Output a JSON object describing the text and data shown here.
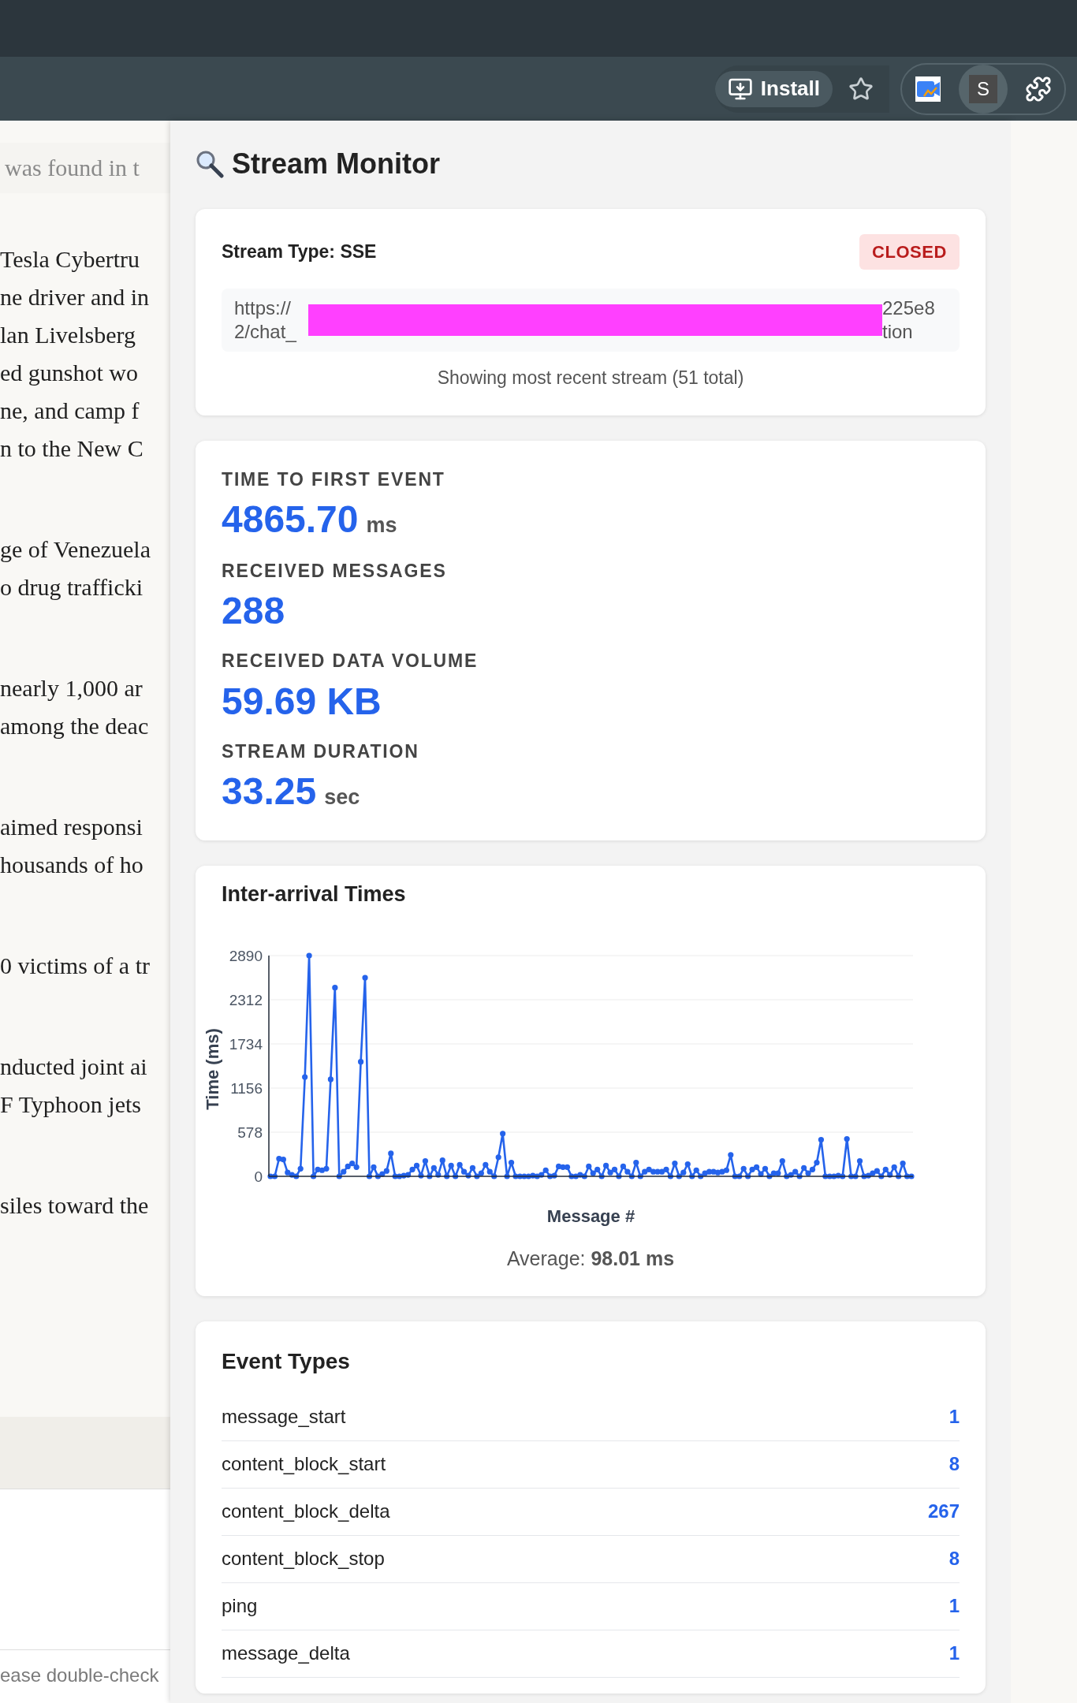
{
  "browser_toolbar": {
    "install_button": "Install",
    "avatar_initial": "S"
  },
  "background_page": {
    "summary": "was found in t",
    "paragraphs": [
      [
        "Tesla Cybertru",
        "ne driver and in",
        "lan Livelsberg",
        "ed gunshot wo",
        "ne, and camp f",
        "n to the New C"
      ],
      [
        "ge of Venezuela",
        "o drug trafficki"
      ],
      [
        "nearly 1,000 ar",
        "among the deac"
      ],
      [
        "aimed responsi",
        "housands of ho"
      ],
      [
        "0 victims of a tr"
      ],
      [
        "nducted joint ai",
        "F Typhoon jets"
      ],
      [
        "siles toward the"
      ]
    ],
    "footer_text": "ease double-check"
  },
  "panel": {
    "title": "Stream Monitor",
    "stream_card": {
      "stream_type": "Stream Type: SSE",
      "status": {
        "label": "CLOSED",
        "kind": "closed"
      },
      "url_lines": [
        {
          "start": "https://",
          "end": "225e8"
        },
        {
          "start": "2/chat_",
          "end": "tion"
        }
      ],
      "note": "Showing most recent stream (51 total)"
    },
    "metrics": [
      {
        "label": "TIME TO FIRST EVENT",
        "value": "4865.70",
        "unit": "ms"
      },
      {
        "label": "RECEIVED MESSAGES",
        "value": "288"
      },
      {
        "label": "RECEIVED DATA VOLUME",
        "value": "59.69 KB"
      },
      {
        "label": "STREAM DURATION",
        "value": "33.25",
        "unit": "sec"
      }
    ],
    "inter_arrival": {
      "title": "Inter-arrival Times",
      "chart_data": {
        "type": "line",
        "xlabel": "Message #",
        "ylabel": "Time (ms)",
        "ylim": [
          0,
          2890
        ],
        "yticks": [
          0,
          578,
          1156,
          1734,
          2312,
          2890
        ],
        "grid": true,
        "series": [
          {
            "color": "#2563eb",
            "marker": "circle",
            "values": [
              0,
              0,
              230,
              220,
              50,
              20,
              0,
              100,
              1300,
              2890,
              0,
              90,
              80,
              100,
              1270,
              2470,
              0,
              60,
              130,
              170,
              120,
              1500,
              2600,
              0,
              120,
              0,
              30,
              70,
              300,
              0,
              0,
              10,
              20,
              90,
              140,
              10,
              200,
              0,
              110,
              20,
              210,
              0,
              140,
              0,
              150,
              60,
              10,
              110,
              0,
              40,
              150,
              60,
              0,
              250,
              560,
              0,
              180,
              0,
              0,
              0,
              0,
              10,
              0,
              20,
              80,
              0,
              10,
              130,
              120,
              120,
              0,
              0,
              20,
              0,
              130,
              40,
              90,
              0,
              140,
              50,
              90,
              0,
              130,
              60,
              0,
              180,
              0,
              60,
              90,
              60,
              60,
              60,
              90,
              0,
              170,
              0,
              50,
              160,
              0,
              80,
              0,
              40,
              60,
              60,
              50,
              60,
              80,
              280,
              0,
              0,
              100,
              0,
              90,
              120,
              30,
              100,
              0,
              40,
              40,
              200,
              0,
              20,
              60,
              0,
              110,
              40,
              90,
              180,
              480,
              0,
              0,
              0,
              10,
              0,
              490,
              0,
              0,
              200,
              0,
              10,
              40,
              70,
              0,
              90,
              20,
              120,
              0,
              170,
              0,
              0
            ]
          }
        ]
      },
      "average": "Average: **98.01 ms**"
    },
    "event_types": {
      "title": "Event Types",
      "rows": [
        {
          "name": "message_start",
          "count": "1"
        },
        {
          "name": "content_block_start",
          "count": "8"
        },
        {
          "name": "content_block_delta",
          "count": "267"
        },
        {
          "name": "content_block_stop",
          "count": "8"
        },
        {
          "name": "ping",
          "count": "1"
        },
        {
          "name": "message_delta",
          "count": "1"
        }
      ]
    }
  }
}
